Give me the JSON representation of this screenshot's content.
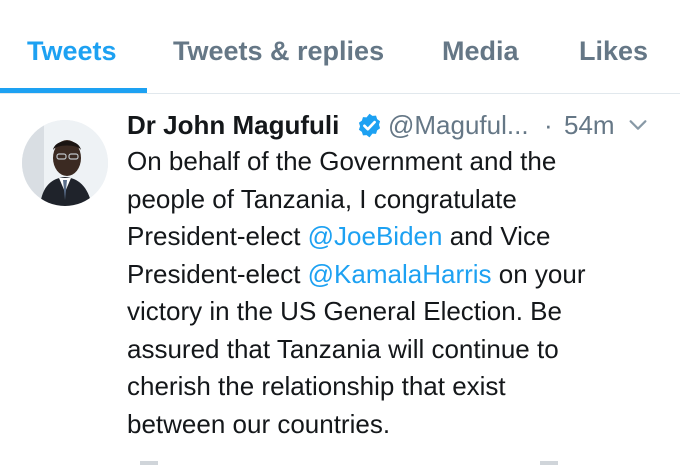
{
  "tabs": [
    {
      "label": "Tweets",
      "active": true
    },
    {
      "label": "Tweets & replies",
      "active": false
    },
    {
      "label": "Media",
      "active": false
    },
    {
      "label": "Likes",
      "active": false
    }
  ],
  "tweet": {
    "display_name": "Dr John Magufuli",
    "verified": true,
    "handle": "@Maguful...",
    "separator": "·",
    "timestamp": "54m",
    "body_lines": [
      [
        {
          "text": "On behalf of the Government and the"
        }
      ],
      [
        {
          "text": "people of Tanzania, I congratulate"
        }
      ],
      [
        {
          "text": "President-elect "
        },
        {
          "text": "@JoeBiden",
          "mention": true
        },
        {
          "text": " and Vice"
        }
      ],
      [
        {
          "text": "President-elect "
        },
        {
          "text": "@KamalaHarris",
          "mention": true
        },
        {
          "text": " on your"
        }
      ],
      [
        {
          "text": "victory in the US General Election. Be"
        }
      ],
      [
        {
          "text": "assured that Tanzania will continue to"
        }
      ],
      [
        {
          "text": "cherish the relationship that exist"
        }
      ],
      [
        {
          "text": "between our countries."
        }
      ]
    ]
  },
  "colors": {
    "accent": "#1da1f2",
    "text": "#14171a",
    "secondary_text": "#657786",
    "divider": "#e1e8ed"
  },
  "icons": {
    "verified": "verified-badge-icon",
    "caret": "chevron-down-icon"
  }
}
